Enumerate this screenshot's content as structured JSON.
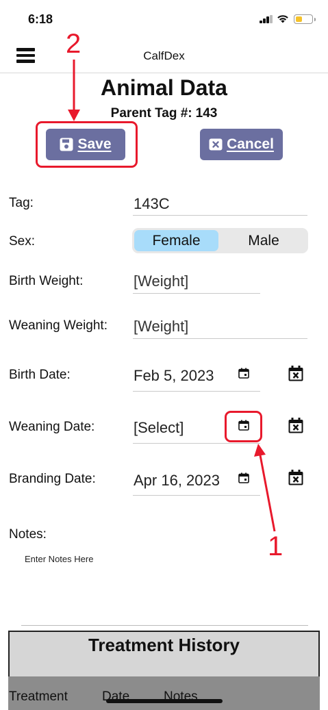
{
  "status_bar": {
    "time": "6:18"
  },
  "header": {
    "app_title": "CalfDex",
    "menu_icon": "hamburger-menu-icon"
  },
  "page": {
    "title": "Animal Data",
    "parent_tag_label": "Parent Tag #:",
    "parent_tag_value": "143"
  },
  "actions": {
    "save_label": "Save",
    "cancel_label": "Cancel",
    "save_icon": "floppy-disk-icon",
    "cancel_icon": "x-box-icon",
    "button_color": "#6b6fa0"
  },
  "form": {
    "tag": {
      "label": "Tag:",
      "value": "143C"
    },
    "sex": {
      "label": "Sex:",
      "options": [
        "Female",
        "Male"
      ],
      "selected": "Female",
      "selected_color": "#a8dcfa"
    },
    "birth_weight": {
      "label": "Birth Weight:",
      "value": "[Weight]"
    },
    "weaning_weight": {
      "label": "Weaning Weight:",
      "value": "[Weight]"
    },
    "birth_date": {
      "label": "Birth Date:",
      "value": "Feb 5, 2023"
    },
    "weaning_date": {
      "label": "Weaning Date:",
      "value": "[Select]"
    },
    "branding_date": {
      "label": "Branding Date:",
      "value": "Apr 16, 2023"
    },
    "notes": {
      "label": "Notes:",
      "placeholder": "Enter Notes Here"
    }
  },
  "treatment_history": {
    "title": "Treatment History",
    "columns": [
      "Treatment",
      "Date",
      "Notes"
    ]
  },
  "annotations": {
    "step_1": "1",
    "step_2": "2",
    "color": "#e8192c"
  }
}
